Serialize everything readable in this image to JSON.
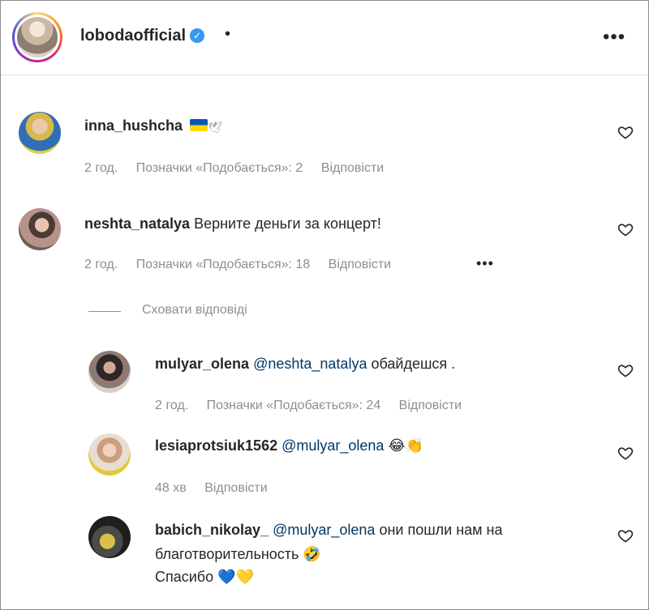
{
  "header": {
    "username": "lobodaofficial",
    "separator": "•",
    "more": "•••"
  },
  "comments": [
    {
      "username": "inna_hushcha",
      "text": "",
      "emoji": "🇺🇦🕊",
      "time": "2 год.",
      "likes": "Позначки «Подобається»: 2",
      "reply": "Відповісти"
    },
    {
      "username": "neshta_natalya",
      "text": "Верните деньги за концерт!",
      "time": "2 год.",
      "likes": "Позначки «Подобається»: 18",
      "reply": "Відповісти",
      "more": "•••"
    }
  ],
  "hide_replies": "Сховати відповіді",
  "replies": [
    {
      "username": "mulyar_olena",
      "mention": "@neshta_natalya",
      "text": "обайдешся .",
      "time": "2 год.",
      "likes": "Позначки «Подобається»: 24",
      "reply": "Відповісти"
    },
    {
      "username": "lesiaprotsiuk1562",
      "mention": "@mulyar_olena",
      "text": "😂👏",
      "time": "48 хв",
      "reply": "Відповісти"
    },
    {
      "username": "babich_nikolay_",
      "mention": "@mulyar_olena",
      "text": "они пошли нам на",
      "text2": "благотворительность 🤣",
      "text3": "Спасибо 💙💛"
    }
  ],
  "colors": {
    "text": "#262626",
    "muted": "#8e8e8e",
    "mention": "#00376b",
    "verified": "#3897f0"
  }
}
